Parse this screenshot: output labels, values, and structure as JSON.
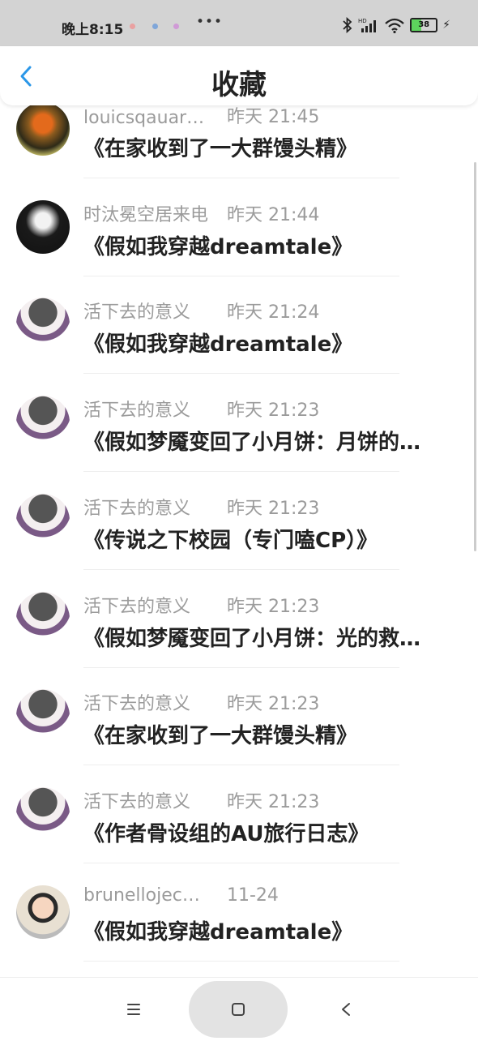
{
  "status_bar": {
    "time": "晚上8:15",
    "dots": "•••",
    "battery": "38",
    "icons": [
      "notification-icon",
      "notification-icon",
      "notification-icon",
      "bluetooth-icon",
      "signal-icon",
      "wifi-icon",
      "battery-icon",
      "charging-icon"
    ],
    "battery_color": "#5dd35d"
  },
  "header": {
    "title": "收藏",
    "back_icon": "chevron-left-icon",
    "accent": "#2b97e8"
  },
  "items": [
    {
      "name": "louicsqauar…",
      "time": "昨天 21:45",
      "title": "《在家收到了一大群馒头精》",
      "avatar": "pumpkin"
    },
    {
      "name": "时汰冕空居来电",
      "time": "昨天 21:44",
      "title": "《假如我穿越dreamtale》",
      "avatar": "dark"
    },
    {
      "name": "活下去的意义",
      "time": "昨天 21:24",
      "title": "《假如我穿越dreamtale》",
      "avatar": "anime"
    },
    {
      "name": "活下去的意义",
      "time": "昨天 21:23",
      "title": "《假如梦魇变回了小月饼：月饼的…",
      "avatar": "anime"
    },
    {
      "name": "活下去的意义",
      "time": "昨天 21:23",
      "title": "《传说之下校园（专门嗑CP）》",
      "avatar": "anime"
    },
    {
      "name": "活下去的意义",
      "time": "昨天 21:23",
      "title": "《假如梦魇变回了小月饼：光的救…",
      "avatar": "anime"
    },
    {
      "name": "活下去的意义",
      "time": "昨天 21:23",
      "title": "《在家收到了一大群馒头精》",
      "avatar": "anime"
    },
    {
      "name": "活下去的意义",
      "time": "昨天 21:23",
      "title": "《作者骨设组的AU旅行日志》",
      "avatar": "anime"
    },
    {
      "name": "brunellojec…",
      "time": "11-24",
      "title": "《假如我穿越dreamtale》",
      "avatar": "child"
    }
  ],
  "nav": {
    "menu_icon": "menu-icon",
    "home_icon": "home-square-icon",
    "back_icon": "back-triangle-icon"
  }
}
